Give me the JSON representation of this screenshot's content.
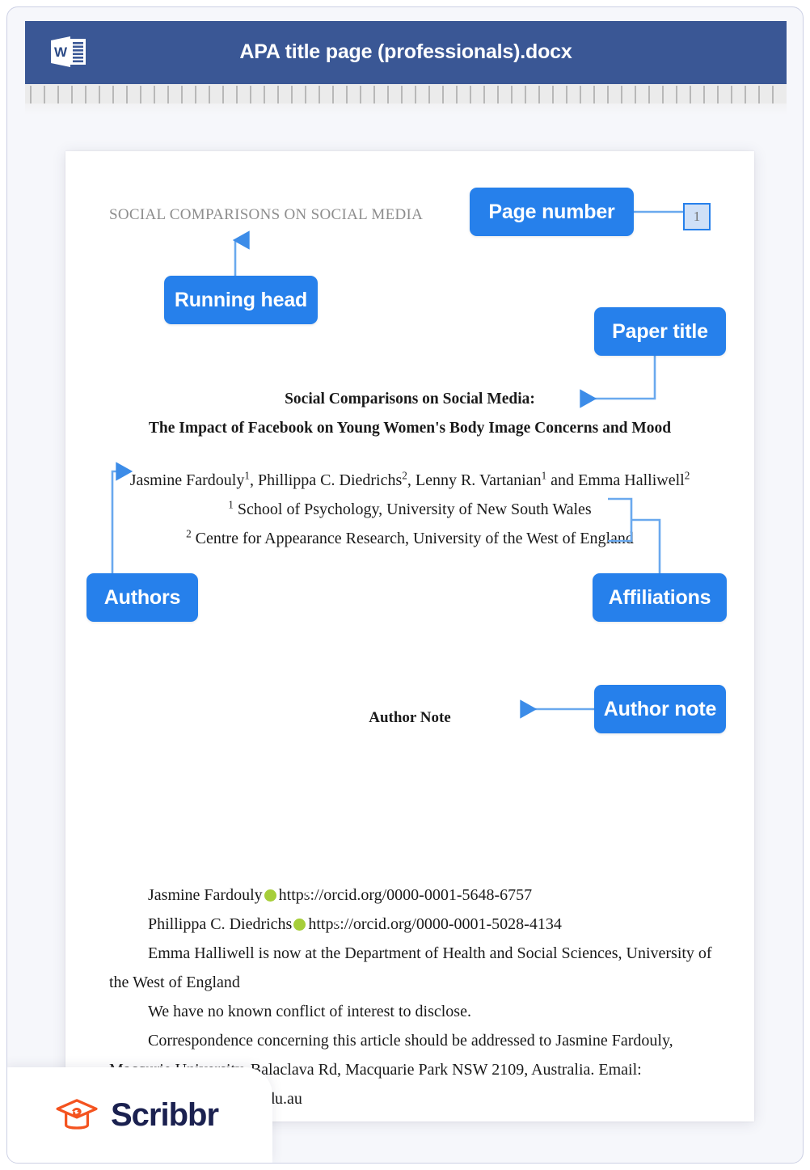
{
  "window": {
    "title": "APA title page (professionals).docx",
    "app_icon": "word-icon",
    "header_color": "#3a5795"
  },
  "ruler": {
    "tick_count": 55,
    "tick_spacing_px": 17
  },
  "document": {
    "running_head": "SOCIAL COMPARISONS ON SOCIAL MEDIA",
    "page_number": "1",
    "title_line_1": "Social Comparisons on Social Media:",
    "title_line_2": "The Impact of Facebook on Young Women's Body Image Concerns and Mood",
    "authors": {
      "a1_name": "Jasmine Fardouly",
      "a1_sup": "1",
      "sep1": ", ",
      "a2_name": "Phillippa C. Diedrichs",
      "a2_sup": "2",
      "sep2": ", ",
      "a3_name": "Lenny R. Vartanian",
      "a3_sup": "1",
      "sep3": " and ",
      "a4_name": "Emma Halliwell",
      "a4_sup": "2"
    },
    "affiliation_1": {
      "sup": "1",
      "text": "School of Psychology, University of New South Wales"
    },
    "affiliation_2": {
      "sup": "2",
      "text": "Centre for Appearance Research, University of the West of England"
    },
    "author_note": {
      "heading": "Author Note",
      "orcid_line_1": {
        "name": "Jasmine Fardouly",
        "icon": "orcid-icon",
        "url": "https://orcid.org/0000-0001-5648-6757"
      },
      "orcid_line_2": {
        "name": "Phillippa C. Diedrichs",
        "icon": "orcid-icon",
        "url": "https://orcid.org/0000-0001-5028-4134"
      },
      "paragraph_1": "Emma Halliwell is now at the Department of Health and Social Sciences, University of the West of England",
      "paragraph_2": "We have no known conflict of interest to disclose.",
      "paragraph_3": "Correspondence concerning this article should be addressed to Jasmine Fardouly, Macqurie University, Balaclava Rd, Macquarie Park NSW 2109, Australia. Email: Jasmine.fardouly@mq.edu.au"
    }
  },
  "annotations": {
    "accent_color": "#2680eb",
    "running_head": "Running head",
    "page_number": "Page number",
    "paper_title": "Paper title",
    "authors": "Authors",
    "affiliations": "Affiliations",
    "author_note": "Author note"
  },
  "footer": {
    "brand": "Scribbr",
    "logo_icon": "graduation-cap-icon",
    "logo_color": "#f4531f",
    "wordmark_color": "#1b2150"
  }
}
